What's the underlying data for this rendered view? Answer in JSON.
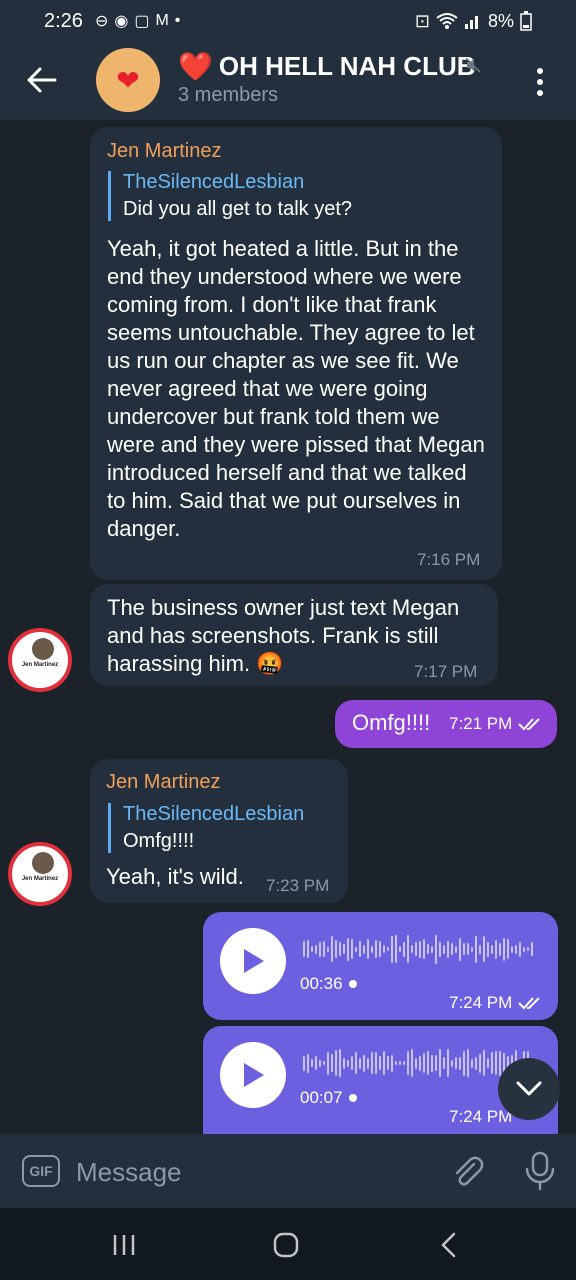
{
  "status_bar": {
    "time": "2:26",
    "battery": "8%"
  },
  "header": {
    "title": "OH HELL NAH CLUB",
    "title_emoji": "❤️",
    "members": "3 members"
  },
  "messages": [
    {
      "sender": "Jen Martinez",
      "reply_to_name": "TheSilencedLesbian",
      "reply_to_text": "Did you all get to talk yet?",
      "text": "Yeah, it got heated a little. But in the end they understood where we were coming from. I don't like that frank seems untouchable. They agree to let us run our chapter as we see fit. We never agreed that we were going undercover but frank told them we were and they were pissed that Megan introduced herself and that we talked to him. Said that we put ourselves in danger.",
      "time": "7:16 PM"
    },
    {
      "text": "The business owner just text Megan and has screenshots. Frank is still harassing him. 🤬",
      "time": "7:17 PM",
      "avatar_name": "Jen Martinez"
    },
    {
      "text": "Omfg!!!!",
      "time": "7:21 PM",
      "outgoing": true
    },
    {
      "sender": "Jen Martinez",
      "reply_to_name": "TheSilencedLesbian",
      "reply_to_text": "Omfg!!!!",
      "text": "Yeah, it's wild.",
      "time": "7:23 PM",
      "avatar_name": "Jen Martinez"
    },
    {
      "type": "voice",
      "duration": "00:36",
      "time": "7:24 PM",
      "outgoing": true
    },
    {
      "type": "voice",
      "duration": "00:07",
      "time": "7:24 PM",
      "outgoing": true
    }
  ],
  "input": {
    "gif_label": "GIF",
    "placeholder": "Message"
  },
  "colors": {
    "incoming_bubble": "#242f3d",
    "outgoing_bubble": "#8e44d6",
    "voice_bubble": "#6c5fe0",
    "sender_name": "#f0a05a",
    "reply_accent": "#5caef2"
  }
}
